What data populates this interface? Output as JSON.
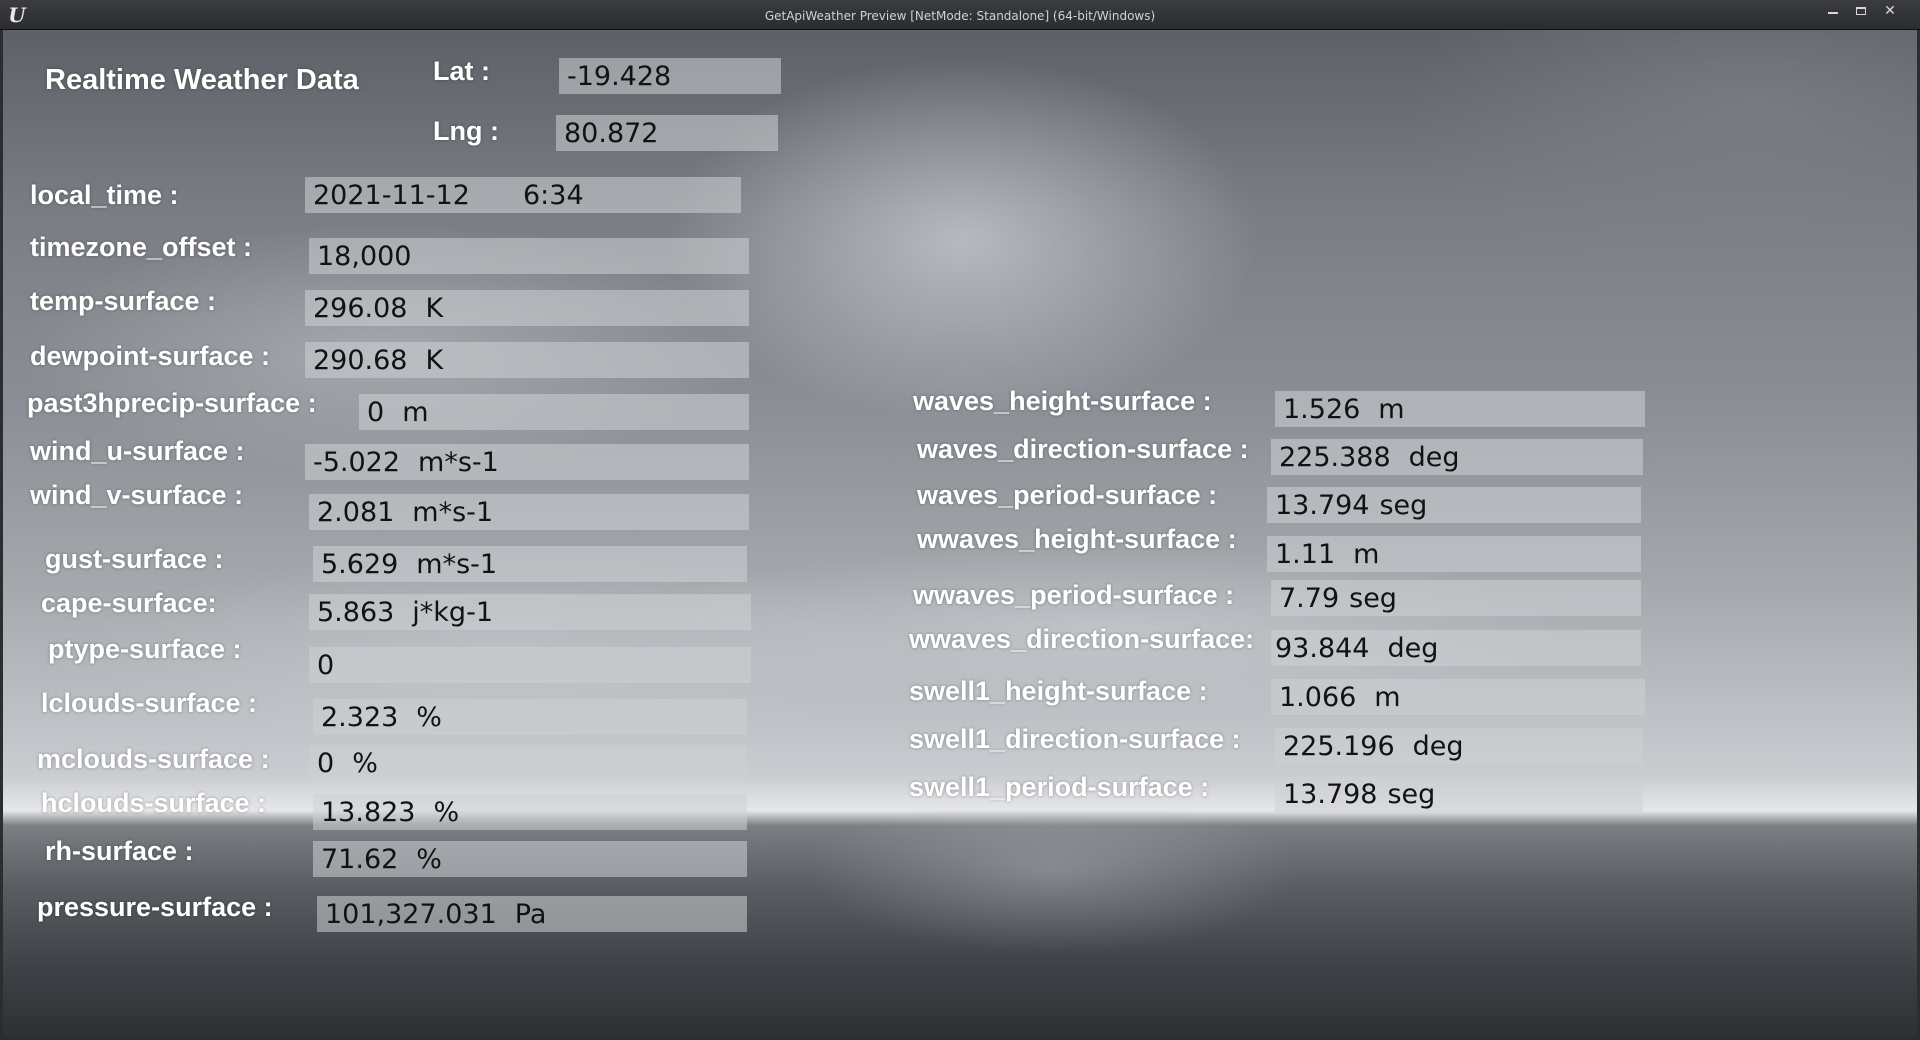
{
  "window": {
    "title": "GetApiWeather Preview [NetMode: Standalone]  (64-bit/Windows)",
    "logo": "U"
  },
  "header": {
    "title": "Realtime Weather Data",
    "lat_label": "Lat :",
    "lat_value": "-19.428",
    "lng_label": "Lng :",
    "lng_value": "80.872"
  },
  "local_time": {
    "label": "local_time :",
    "date": "2021-11-12",
    "time": "6:34"
  },
  "left_fields": [
    {
      "label": "timezone_offset :",
      "value": "18,000",
      "unit": ""
    },
    {
      "label": "temp-surface :",
      "value": "296.08",
      "unit": "K"
    },
    {
      "label": "dewpoint-surface :",
      "value": "290.68",
      "unit": "K"
    },
    {
      "label": "past3hprecip-surface :",
      "value": "0",
      "unit": "m"
    },
    {
      "label": "wind_u-surface :",
      "value": "-5.022",
      "unit": "m*s-1"
    },
    {
      "label": "wind_v-surface :",
      "value": "2.081",
      "unit": "m*s-1"
    },
    {
      "label": "gust-surface :",
      "value": "5.629",
      "unit": "m*s-1"
    },
    {
      "label": "cape-surface:",
      "value": "5.863",
      "unit": "j*kg-1"
    },
    {
      "label": "ptype-surface :",
      "value": "0",
      "unit": ""
    },
    {
      "label": "lclouds-surface :",
      "value": "2.323",
      "unit": "%"
    },
    {
      "label": "mclouds-surface :",
      "value": "0",
      "unit": "%"
    },
    {
      "label": "hclouds-surface :",
      "value": "13.823",
      "unit": "%"
    },
    {
      "label": "rh-surface :",
      "value": "71.62",
      "unit": "%"
    },
    {
      "label": "pressure-surface :",
      "value": "101,327.031",
      "unit": "Pa"
    }
  ],
  "right_fields": [
    {
      "label": "waves_height-surface :",
      "value": "1.526",
      "unit": "m"
    },
    {
      "label": "waves_direction-surface :",
      "value": "225.388",
      "unit": "deg"
    },
    {
      "label": "waves_period-surface :",
      "value": "13.794",
      "unit": "seg"
    },
    {
      "label": "wwaves_height-surface :",
      "value": "1.11",
      "unit": "m"
    },
    {
      "label": "wwaves_period-surface :",
      "value": "7.79",
      "unit": "seg"
    },
    {
      "label": "wwaves_direction-surface:",
      "value": "93.844",
      "unit": "deg"
    },
    {
      "label": "swell1_height-surface :",
      "value": "1.066",
      "unit": "m"
    },
    {
      "label": "swell1_direction-surface :",
      "value": "225.196",
      "unit": "deg"
    },
    {
      "label": "swell1_period-surface :",
      "value": "13.798",
      "unit": "seg"
    }
  ]
}
